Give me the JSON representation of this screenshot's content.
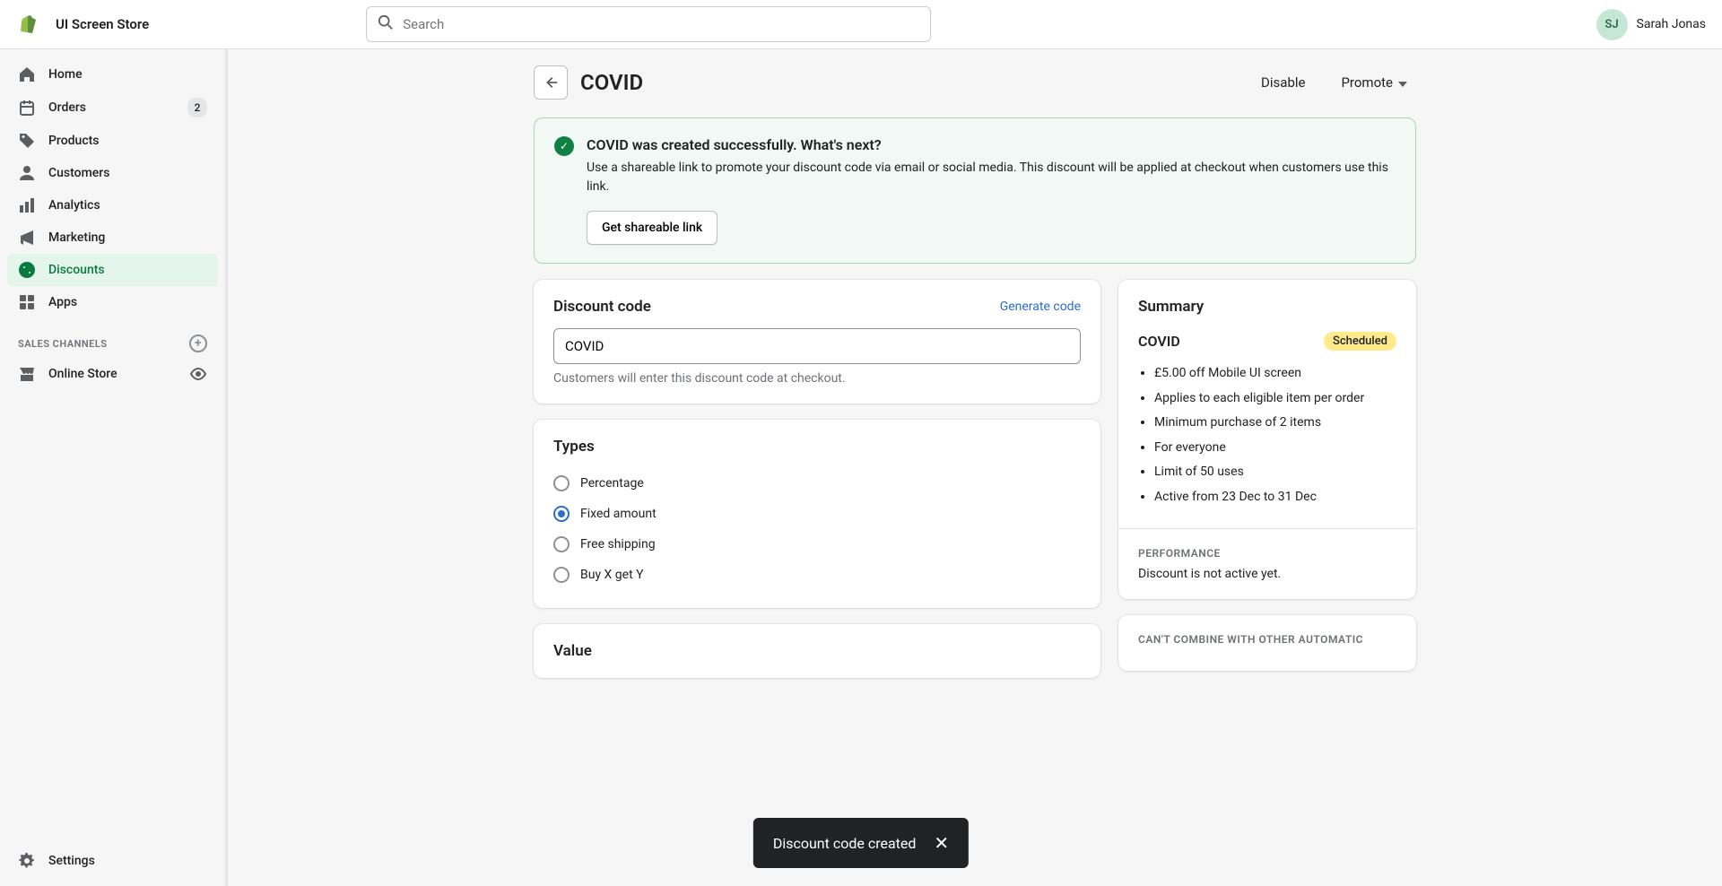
{
  "topbar": {
    "store_name": "UI Screen Store",
    "search_placeholder": "Search",
    "user_initials": "SJ",
    "user_name": "Sarah Jonas"
  },
  "sidebar": {
    "items": [
      {
        "label": "Home"
      },
      {
        "label": "Orders",
        "badge": "2"
      },
      {
        "label": "Products"
      },
      {
        "label": "Customers"
      },
      {
        "label": "Analytics"
      },
      {
        "label": "Marketing"
      },
      {
        "label": "Discounts",
        "active": true
      },
      {
        "label": "Apps"
      }
    ],
    "section_heading": "SALES CHANNELS",
    "channels": [
      {
        "label": "Online Store"
      }
    ],
    "settings_label": "Settings"
  },
  "page": {
    "title": "COVID",
    "disable_label": "Disable",
    "promote_label": "Promote"
  },
  "banner": {
    "title": "COVID was created successfully. What's next?",
    "body": "Use a shareable link to promote your discount code via email or social media. This discount will be applied at checkout when customers use this link.",
    "action_label": "Get shareable link"
  },
  "discount_code": {
    "heading": "Discount code",
    "generate_label": "Generate code",
    "value": "COVID",
    "help": "Customers will enter this discount code at checkout."
  },
  "types": {
    "heading": "Types",
    "options": [
      {
        "label": "Percentage",
        "checked": false
      },
      {
        "label": "Fixed amount",
        "checked": true
      },
      {
        "label": "Free shipping",
        "checked": false
      },
      {
        "label": "Buy X get Y",
        "checked": false
      }
    ]
  },
  "value": {
    "heading": "Value"
  },
  "summary": {
    "heading": "Summary",
    "name": "COVID",
    "status": "Scheduled",
    "items": [
      "£5.00 off Mobile UI screen",
      "Applies to each eligible item per order",
      "Minimum purchase of 2 items",
      "For everyone",
      "Limit of 50 uses",
      "Active from 23 Dec to 31 Dec"
    ],
    "performance_label": "PERFORMANCE",
    "performance_text": "Discount is not active yet.",
    "cant_combine_label": "CAN'T COMBINE WITH OTHER AUTOMATIC"
  },
  "toast": {
    "message": "Discount code created"
  }
}
